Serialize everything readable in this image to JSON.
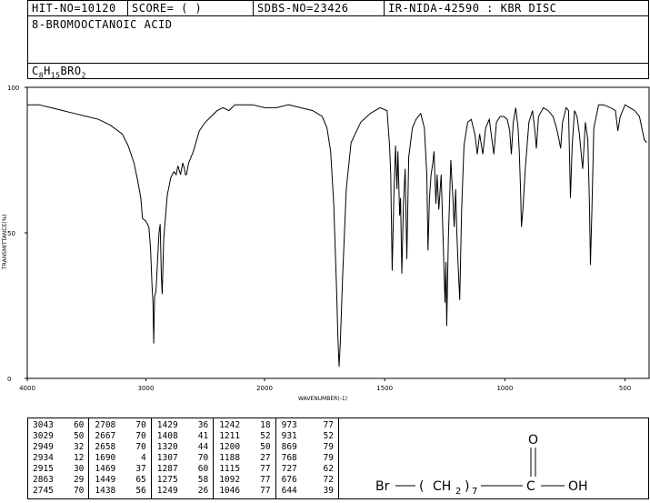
{
  "header": {
    "hit_no": "HIT-NO=10120",
    "score": "SCORE=  (   )",
    "sdbs_no": "SDBS-NO=23426",
    "ir_info": "IR-NIDA-42590 : KBR DISC"
  },
  "compound_name": "8-BROMOOCTANOIC ACID",
  "formula": {
    "c": "C",
    "c_n": "8",
    "h": "H",
    "h_n": "15",
    "rest": "BRO",
    "o_n": "2"
  },
  "structure": {
    "br": "Br",
    "open": "(",
    "ch2": "CH",
    "ch2_sub": "2",
    "close": ")",
    "n": "7",
    "c": "C",
    "o": "O",
    "oh": "OH"
  },
  "peaks": [
    [
      3043,
      60
    ],
    [
      3029,
      50
    ],
    [
      2949,
      32
    ],
    [
      2934,
      12
    ],
    [
      2915,
      30
    ],
    [
      2863,
      29
    ],
    [
      2745,
      70
    ],
    [
      2708,
      70
    ],
    [
      2667,
      70
    ],
    [
      2658,
      70
    ],
    [
      1690,
      4
    ],
    [
      1469,
      37
    ],
    [
      1449,
      65
    ],
    [
      1438,
      56
    ],
    [
      1429,
      36
    ],
    [
      1408,
      41
    ],
    [
      1320,
      44
    ],
    [
      1307,
      70
    ],
    [
      1287,
      60
    ],
    [
      1275,
      58
    ],
    [
      1249,
      26
    ],
    [
      1242,
      18
    ],
    [
      1211,
      52
    ],
    [
      1200,
      50
    ],
    [
      1188,
      27
    ],
    [
      1115,
      77
    ],
    [
      1092,
      77
    ],
    [
      1046,
      77
    ],
    [
      973,
      77
    ],
    [
      931,
      52
    ],
    [
      869,
      79
    ],
    [
      768,
      79
    ],
    [
      727,
      62
    ],
    [
      676,
      72
    ],
    [
      644,
      39
    ]
  ],
  "chart_data": {
    "type": "line",
    "xlabel": "WAVENUMBER(-1)",
    "ylabel": "TRANSMITTANCE(%)",
    "xlim": [
      4000,
      400
    ],
    "ylim": [
      0,
      100
    ],
    "x_ticks": [
      4000,
      3000,
      2000,
      1500,
      1000,
      500
    ],
    "y_ticks": [
      0,
      50,
      100
    ],
    "grid": false,
    "series": [
      {
        "x": [
          4000,
          3900,
          3800,
          3700,
          3600,
          3500,
          3400,
          3300,
          3200,
          3150,
          3100,
          3070,
          3043,
          3029,
          3000,
          2975,
          2960,
          2949,
          2940,
          2934,
          2927,
          2915,
          2905,
          2890,
          2880,
          2870,
          2863,
          2850,
          2820,
          2790,
          2765,
          2745,
          2730,
          2708,
          2690,
          2675,
          2667,
          2658,
          2640,
          2600,
          2550,
          2500,
          2450,
          2400,
          2350,
          2300,
          2250,
          2200,
          2100,
          2000,
          1950,
          1900,
          1850,
          1800,
          1760,
          1740,
          1725,
          1712,
          1700,
          1695,
          1690,
          1685,
          1675,
          1660,
          1640,
          1600,
          1560,
          1520,
          1490,
          1480,
          1475,
          1469,
          1462,
          1455,
          1449,
          1445,
          1438,
          1434,
          1429,
          1422,
          1415,
          1408,
          1400,
          1385,
          1370,
          1350,
          1335,
          1325,
          1320,
          1314,
          1307,
          1300,
          1295,
          1287,
          1282,
          1275,
          1265,
          1258,
          1249,
          1245,
          1242,
          1235,
          1225,
          1215,
          1211,
          1205,
          1200,
          1195,
          1188,
          1180,
          1170,
          1155,
          1140,
          1125,
          1115,
          1105,
          1092,
          1080,
          1065,
          1046,
          1035,
          1020,
          1005,
          990,
          980,
          973,
          965,
          955,
          945,
          940,
          935,
          931,
          925,
          915,
          900,
          885,
          875,
          869,
          860,
          840,
          820,
          800,
          785,
          775,
          768,
          760,
          745,
          735,
          727,
          720,
          710,
          700,
          690,
          680,
          676,
          672,
          665,
          655,
          648,
          644,
          638,
          630,
          610,
          590,
          560,
          540,
          530,
          520,
          500,
          480,
          460,
          440,
          420,
          410
        ],
        "y": [
          94,
          94,
          93,
          92,
          91,
          90,
          89,
          87,
          84,
          80,
          74,
          68,
          62,
          55,
          54,
          52,
          44,
          32,
          26,
          12,
          28,
          30,
          38,
          50,
          53,
          35,
          29,
          48,
          63,
          69,
          71,
          70,
          73,
          70,
          74,
          72,
          70,
          70,
          74,
          78,
          85,
          88,
          90,
          92,
          93,
          92,
          94,
          94,
          94,
          93,
          93,
          94,
          93,
          92,
          90,
          86,
          78,
          60,
          30,
          15,
          4,
          12,
          35,
          65,
          81,
          88,
          91,
          93,
          92,
          80,
          70,
          37,
          62,
          80,
          65,
          78,
          56,
          62,
          36,
          60,
          72,
          41,
          76,
          86,
          89,
          91,
          86,
          70,
          44,
          62,
          70,
          74,
          78,
          60,
          70,
          58,
          70,
          50,
          26,
          40,
          18,
          48,
          75,
          60,
          52,
          65,
          50,
          40,
          27,
          58,
          80,
          88,
          89,
          84,
          77,
          84,
          77,
          86,
          89,
          77,
          88,
          90,
          90,
          89,
          85,
          77,
          88,
          93,
          86,
          78,
          65,
          52,
          58,
          72,
          88,
          92,
          85,
          79,
          90,
          93,
          92,
          90,
          86,
          82,
          79,
          88,
          93,
          92,
          62,
          80,
          92,
          90,
          84,
          75,
          72,
          78,
          88,
          82,
          60,
          39,
          58,
          86,
          94,
          94,
          93,
          92,
          85,
          90,
          94,
          93,
          92,
          90,
          82,
          81
        ]
      }
    ]
  }
}
